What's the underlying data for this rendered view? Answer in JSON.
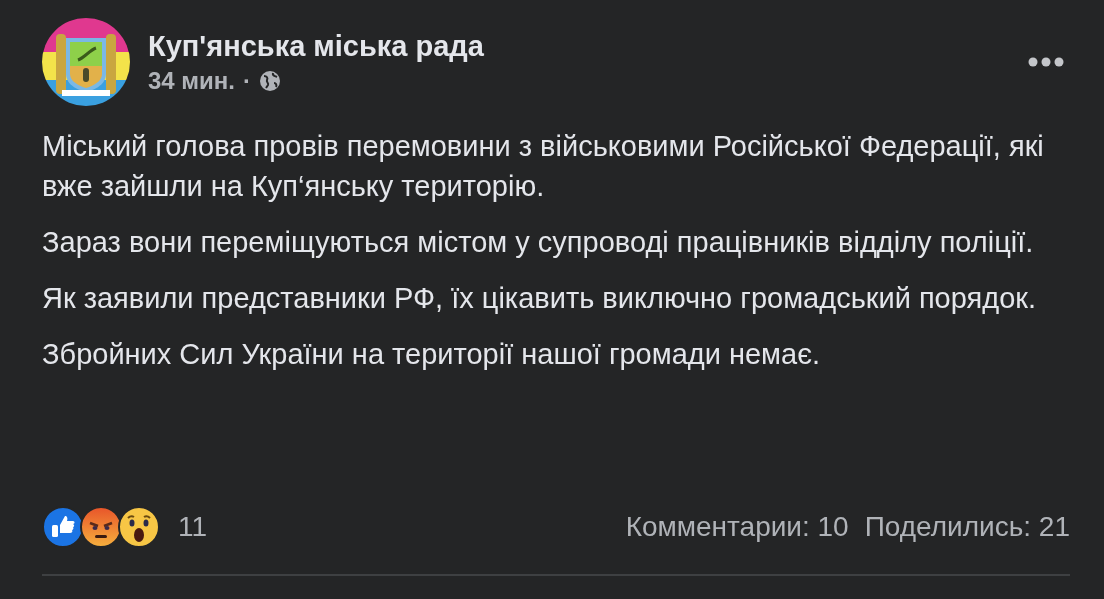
{
  "post": {
    "author": "Куп'янська міська рада",
    "time": "34 мин.",
    "separator": "·",
    "paragraphs": [
      "Міський голова провів перемовини з військовими Російської Федерації, які вже зайшли на Куп‘янську територію.",
      "Зараз вони переміщуються містом у супроводі працівників відділу поліції.",
      "Як заявили представники РФ, їх цікавить виключно громадський порядок.",
      "Збройних Сил України на території нашої громади немає."
    ],
    "reactions": [
      {
        "kind": "like"
      },
      {
        "kind": "angry"
      },
      {
        "kind": "wow"
      }
    ],
    "reaction_count": "11",
    "comments": "Комментарии: 10",
    "shares": "Поделились: 21"
  }
}
